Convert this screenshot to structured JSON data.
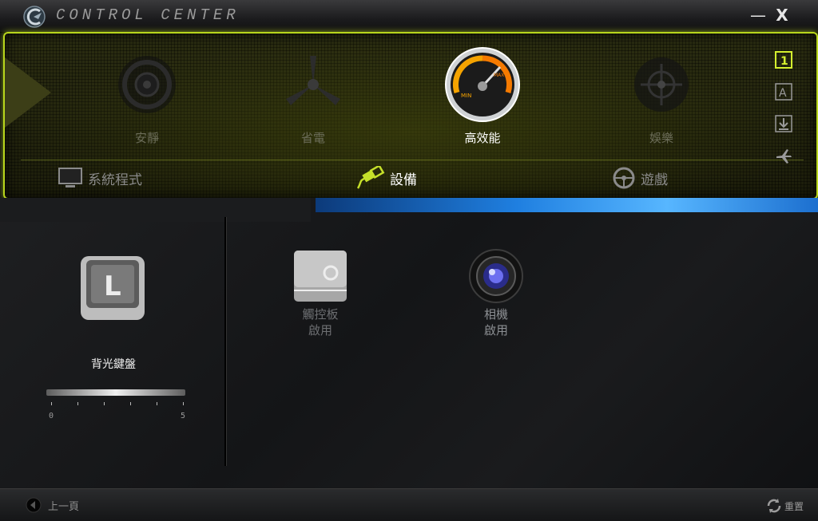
{
  "app": {
    "title": "CONTROL CENTER",
    "minimize": "—",
    "close": "X"
  },
  "modes": [
    {
      "label": "安靜",
      "icon": "speaker-icon"
    },
    {
      "label": "省電",
      "icon": "fan-icon"
    },
    {
      "label": "高效能",
      "icon": "speedometer-icon",
      "active": true
    },
    {
      "label": "娛樂",
      "icon": "crosshair-icon"
    }
  ],
  "categories": [
    {
      "label": "系統程式",
      "icon": "monitor-icon"
    },
    {
      "label": "設備",
      "icon": "usb-plug-icon",
      "active": true
    },
    {
      "label": "遊戲",
      "icon": "steering-wheel-icon"
    }
  ],
  "side_icons": [
    "profile-1-icon",
    "profile-a-icon",
    "download-icon",
    "airplane-icon"
  ],
  "side_text": {
    "one": "1",
    "a": "A"
  },
  "keyboard": {
    "label": "背光鍵盤",
    "key_letter": "L",
    "brightness_level": 3,
    "min_label": "0",
    "max_label": "5"
  },
  "devices": [
    {
      "name": "觸控板",
      "state": "啟用",
      "icon": "touchpad-icon"
    },
    {
      "name": "相機",
      "state": "啟用",
      "icon": "camera-icon"
    }
  ],
  "gauge_text": {
    "min": "MIN",
    "max": "MAX"
  },
  "footer": {
    "back_label": "上一頁",
    "reset_label": "重置"
  },
  "colors": {
    "accent": "#b8d51c",
    "active_text": "#ffffff",
    "inactive_text": "#6b6c58"
  }
}
